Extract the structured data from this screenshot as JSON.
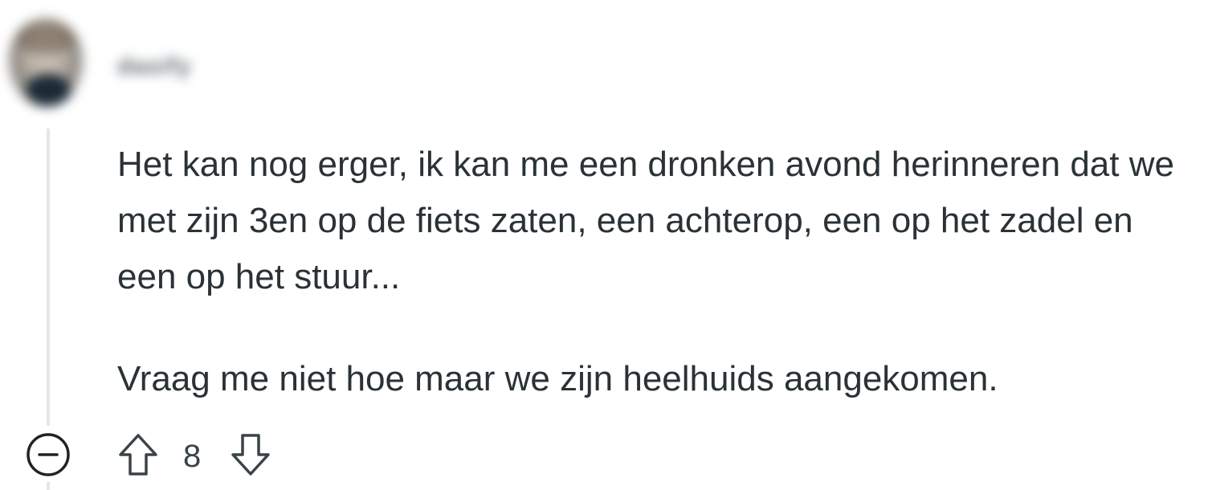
{
  "comment": {
    "username": "dasify",
    "paragraphs": [
      "Het kan nog erger, ik kan me een dronken avond herinneren dat we met zijn 3en op de fiets zaten, een achterop, een op het zadel en een op het stuur...",
      "Vraag me niet hoe maar we zijn heelhuids aangekomen."
    ],
    "score": "8"
  },
  "icons": {
    "collapse": "minus-circle-icon",
    "upvote": "arrow-up-icon",
    "downvote": "arrow-down-icon"
  }
}
